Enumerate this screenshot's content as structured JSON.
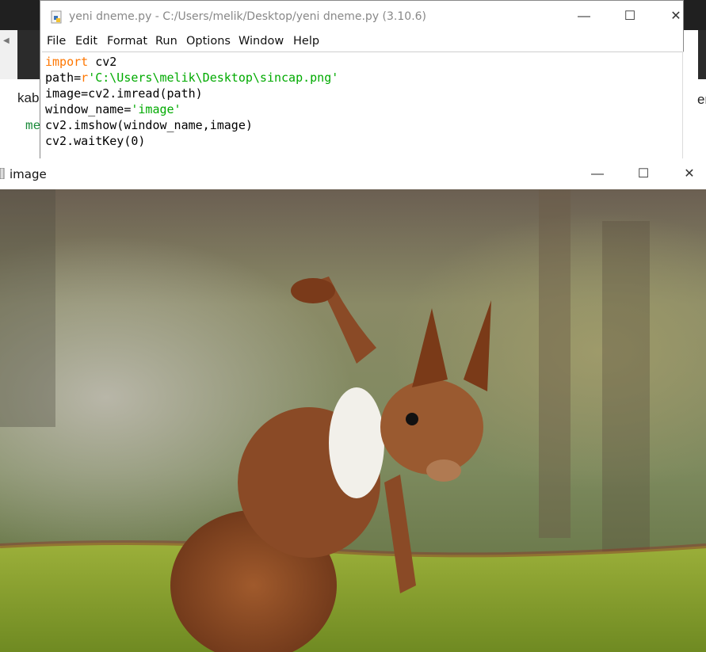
{
  "background_app": {
    "text_left_1": "kab",
    "text_left_2": "me",
    "text_right": "er"
  },
  "idle_window": {
    "title": "yeni dneme.py - C:/Users/melik/Desktop/yeni dneme.py (3.10.6)",
    "icon": "python-file-icon",
    "controls": {
      "minimize": "—",
      "maximize": "☐",
      "close": "✕"
    },
    "menu": [
      "File",
      "Edit",
      "Format",
      "Run",
      "Options",
      "Window",
      "Help"
    ],
    "code": [
      {
        "kw": "import",
        "rest": " cv2"
      },
      {
        "pre": "path=",
        "kw": "r",
        "str": "'C:\\Users\\melik\\Desktop\\sincap.png'"
      },
      {
        "pre": "image=cv2.imread(path)"
      },
      {
        "pre": "window_name=",
        "str": "'image'"
      },
      {
        "pre": "cv2.imshow(window_name,image)"
      },
      {
        "pre": "cv2.waitKey(0)"
      }
    ]
  },
  "image_window": {
    "title": "image",
    "icon": "window-icon",
    "controls": {
      "minimize": "—",
      "maximize": "☐",
      "close": "✕"
    },
    "content": "squirrel-photo"
  },
  "colors": {
    "keyword": "#ff7700",
    "string": "#00aa00"
  }
}
